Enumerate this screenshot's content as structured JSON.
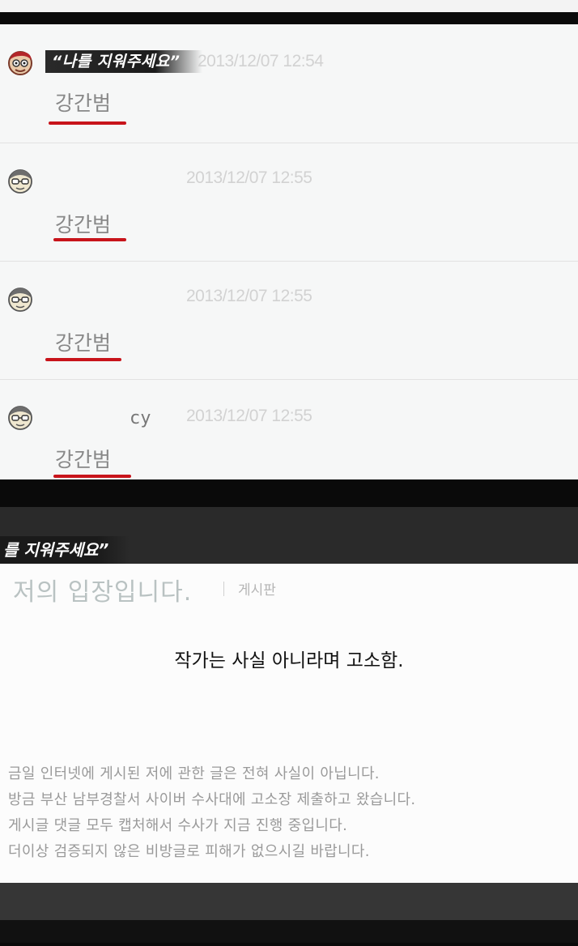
{
  "top_panel": {
    "caption": "“나를 지워주세요”",
    "comments": [
      {
        "author_suffix": "",
        "timestamp": "2013/12/07 12:54",
        "text": "강간범"
      },
      {
        "author_suffix": "",
        "timestamp": "2013/12/07 12:55",
        "text": "강간범"
      },
      {
        "author_suffix": "",
        "timestamp": "2013/12/07 12:55",
        "text": "강간범"
      },
      {
        "author_suffix": "cy",
        "timestamp": "2013/12/07 12:55",
        "text": "강간범"
      }
    ],
    "underline_color": "#c8141b"
  },
  "bottom_panel": {
    "caption": "를 지워주세요”",
    "page_title": "저의 입장입니다.",
    "board_label": "게시판",
    "overlay_text": "작가는 사실 아니라며 고소함.",
    "body_lines": [
      "금일 인터넷에 게시된 저에 관한 글은 전혀 사실이 아닙니다.",
      "방금 부산 남부경찰서 사이버 수사대에 고소장 제출하고 왔습니다.",
      "게시글 댓글 모두 캡처해서 수사가 지금 진행 중입니다.",
      "더이상 검증되지 않은 비방글로 피해가 없으시길 바랍니다."
    ]
  },
  "icons": {
    "avatar": "cartoon-face-icon"
  }
}
